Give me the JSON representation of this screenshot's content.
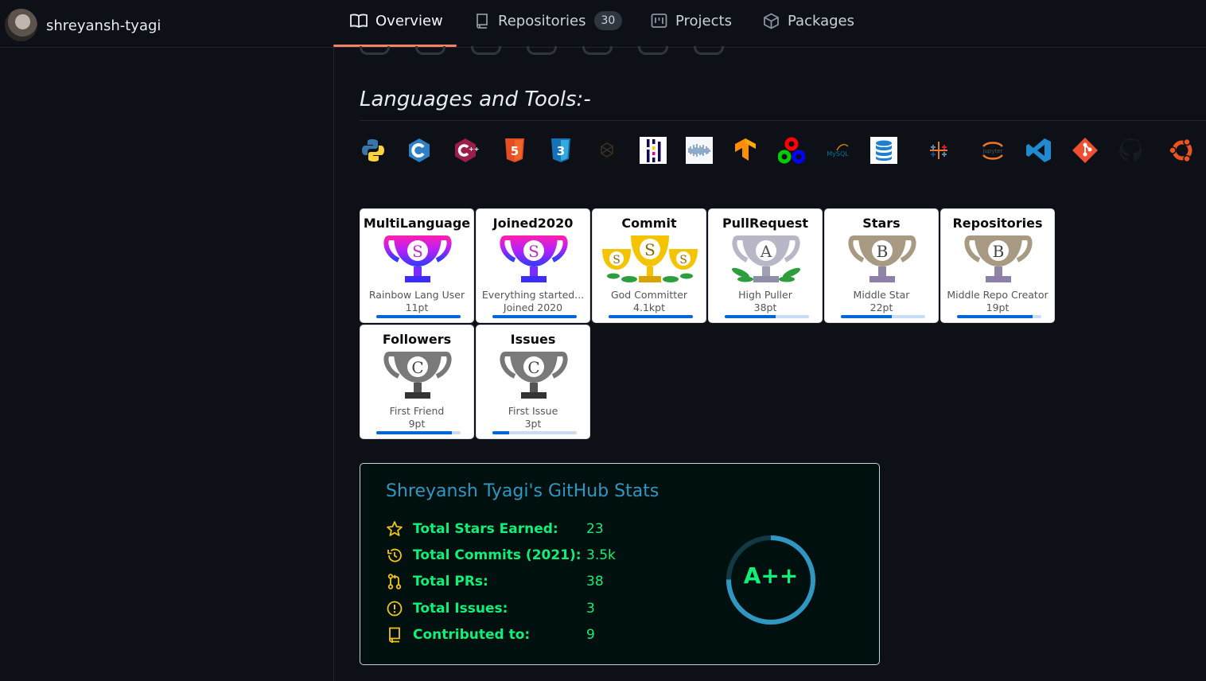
{
  "header": {
    "username": "shreyansh-tyagi",
    "tabs": [
      {
        "label": "Overview",
        "icon": "book-icon",
        "active": true
      },
      {
        "label": "Repositories",
        "icon": "repo-icon",
        "count": "30"
      },
      {
        "label": "Projects",
        "icon": "project-icon"
      },
      {
        "label": "Packages",
        "icon": "package-icon"
      }
    ]
  },
  "languages": {
    "title": "Languages and Tools:-",
    "icons": [
      "python-icon",
      "c-icon",
      "csharp-icon",
      "html5-icon",
      "css3-icon",
      "nextjs-icon",
      "pandas-icon",
      "seaborn-icon",
      "tensorflow-icon",
      "opencv-icon",
      "mysql-icon",
      "database-icon",
      "tableau-icon",
      "jupyter-icon",
      "vscode-icon",
      "git-icon",
      "github-icon",
      "ubuntu-icon"
    ]
  },
  "trophies": [
    {
      "title": "MultiLanguage",
      "rank": "S",
      "desc": "Rainbow Lang User",
      "points": "11pt",
      "progress": 1.0
    },
    {
      "title": "Joined2020",
      "rank": "S",
      "desc": "Everything started...",
      "subdesc": "Joined 2020",
      "progress": 1.0
    },
    {
      "title": "Commit",
      "rank": "S",
      "desc": "God Committer",
      "points": "4.1kpt",
      "progress": 1.0
    },
    {
      "title": "PullRequest",
      "rank": "A",
      "desc": "High Puller",
      "points": "38pt",
      "progress": 0.6
    },
    {
      "title": "Stars",
      "rank": "B",
      "desc": "Middle Star",
      "points": "22pt",
      "progress": 0.6
    },
    {
      "title": "Repositories",
      "rank": "B",
      "desc": "Middle Repo Creator",
      "points": "19pt",
      "progress": 0.9
    },
    {
      "title": "Followers",
      "rank": "C",
      "desc": "First Friend",
      "points": "9pt",
      "progress": 0.9
    },
    {
      "title": "Issues",
      "rank": "C",
      "desc": "First Issue",
      "points": "3pt",
      "progress": 0.2
    }
  ],
  "stats": {
    "title": "Shreyansh Tyagi's GitHub Stats",
    "rows": [
      {
        "label": "Total Stars Earned:",
        "value": "23",
        "icon": "star-icon"
      },
      {
        "label": "Total Commits (2021):",
        "value": "3.5k",
        "icon": "history-icon"
      },
      {
        "label": "Total PRs:",
        "value": "38",
        "icon": "pull-request-icon"
      },
      {
        "label": "Total Issues:",
        "value": "3",
        "icon": "issue-icon"
      },
      {
        "label": "Contributed to:",
        "value": "9",
        "icon": "repo-icon"
      }
    ],
    "rank": "A++"
  },
  "colors": {
    "accent": "#f78166",
    "statsGreen": "#0ff07a",
    "statsTitle": "#2f97c1"
  }
}
